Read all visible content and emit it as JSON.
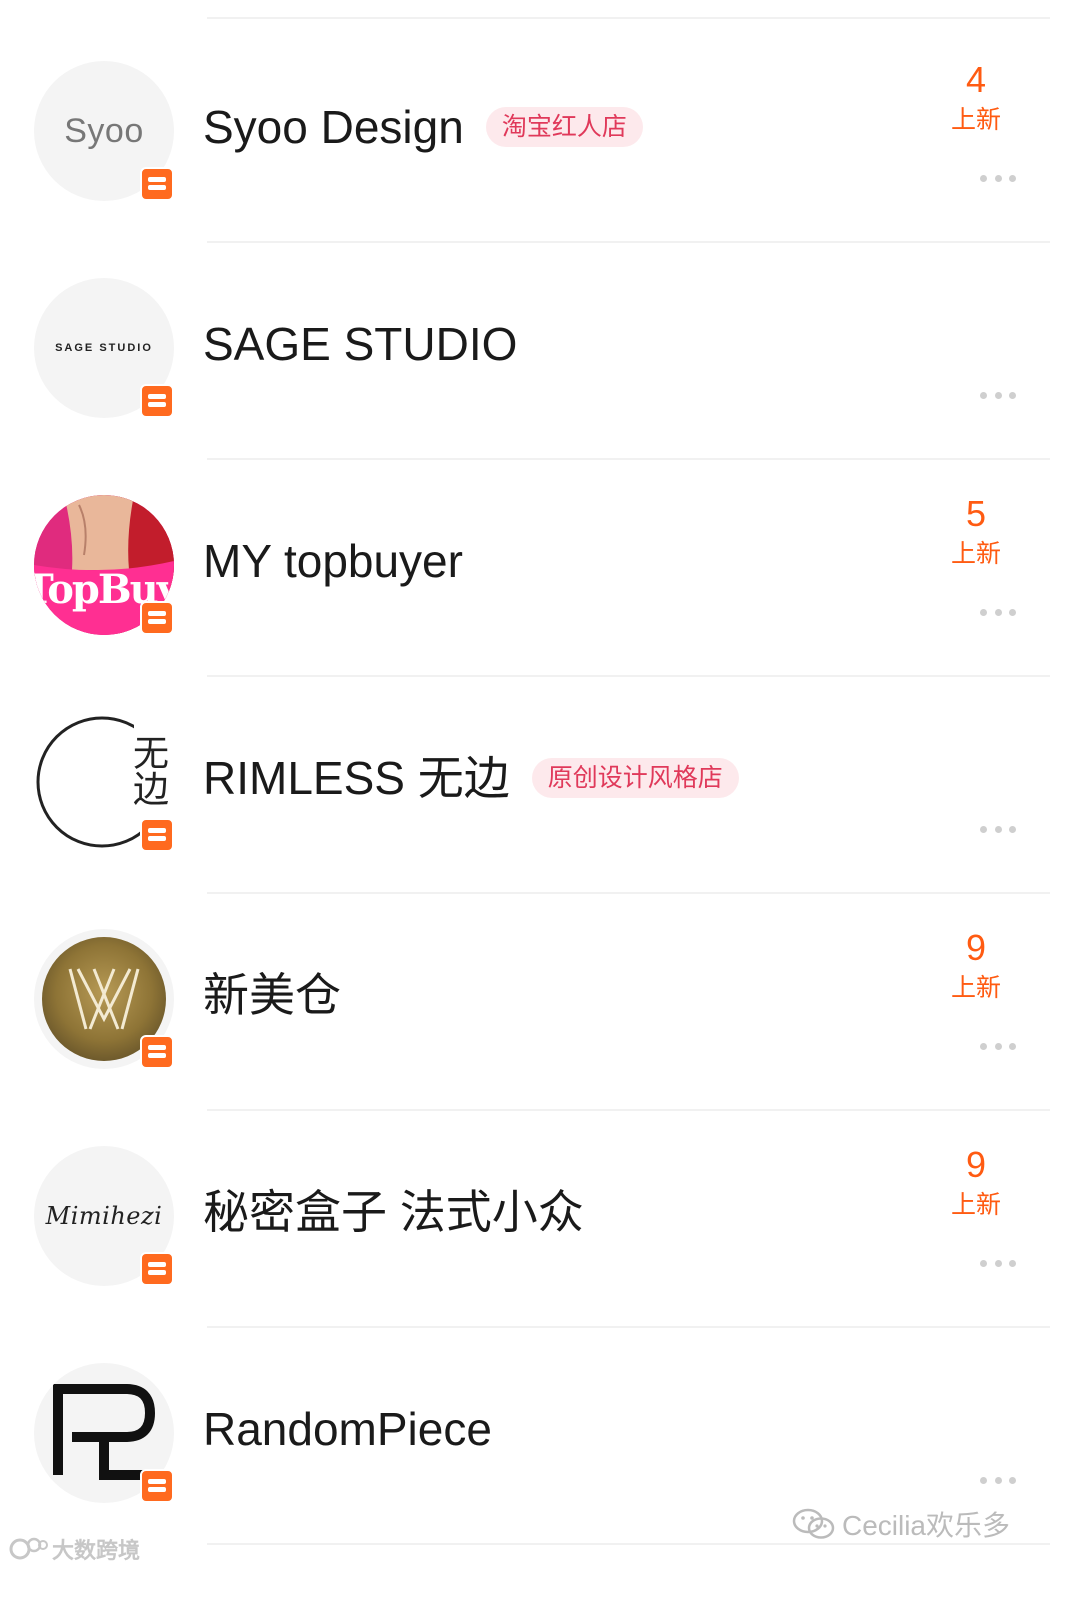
{
  "shops": [
    {
      "name": "Syoo Design",
      "tag": "淘宝红人店",
      "new_count": "4",
      "new_label": "上新",
      "logo_text": "Syoo",
      "logo_icon": "syoo-logo"
    },
    {
      "name": "SAGE STUDIO",
      "tag": "",
      "new_count": "",
      "new_label": "",
      "logo_text": "SAGE STUDIO",
      "logo_icon": "sage-studio-logo"
    },
    {
      "name": "MY topbuyer",
      "tag": "",
      "new_count": "5",
      "new_label": "上新",
      "logo_text": "TopBuy",
      "logo_icon": "topbuyer-photo-logo"
    },
    {
      "name": "RIMLESS 无边",
      "tag": "原创设计风格店",
      "new_count": "",
      "new_label": "",
      "logo_text": "无边",
      "logo_icon": "rimless-circle-logo"
    },
    {
      "name": "新美仓",
      "tag": "",
      "new_count": "9",
      "new_label": "上新",
      "logo_text": "",
      "logo_icon": "gold-monogram-logo"
    },
    {
      "name": "秘密盒子 法式小众",
      "tag": "",
      "new_count": "9",
      "new_label": "上新",
      "logo_text": "Mimihezi",
      "logo_icon": "mimihezi-script-logo"
    },
    {
      "name": "RandomPiece",
      "tag": "",
      "new_count": "",
      "new_label": "",
      "logo_text": "",
      "logo_icon": "rp-monogram-logo"
    }
  ],
  "watermarks": {
    "right": "Cecilia欢乐多",
    "left": "大数跨境"
  },
  "colors": {
    "accent_orange": "#ff5b12",
    "tag_bg": "#fde9ec",
    "tag_text": "#e0395a",
    "badge": "#ff6a1f"
  }
}
